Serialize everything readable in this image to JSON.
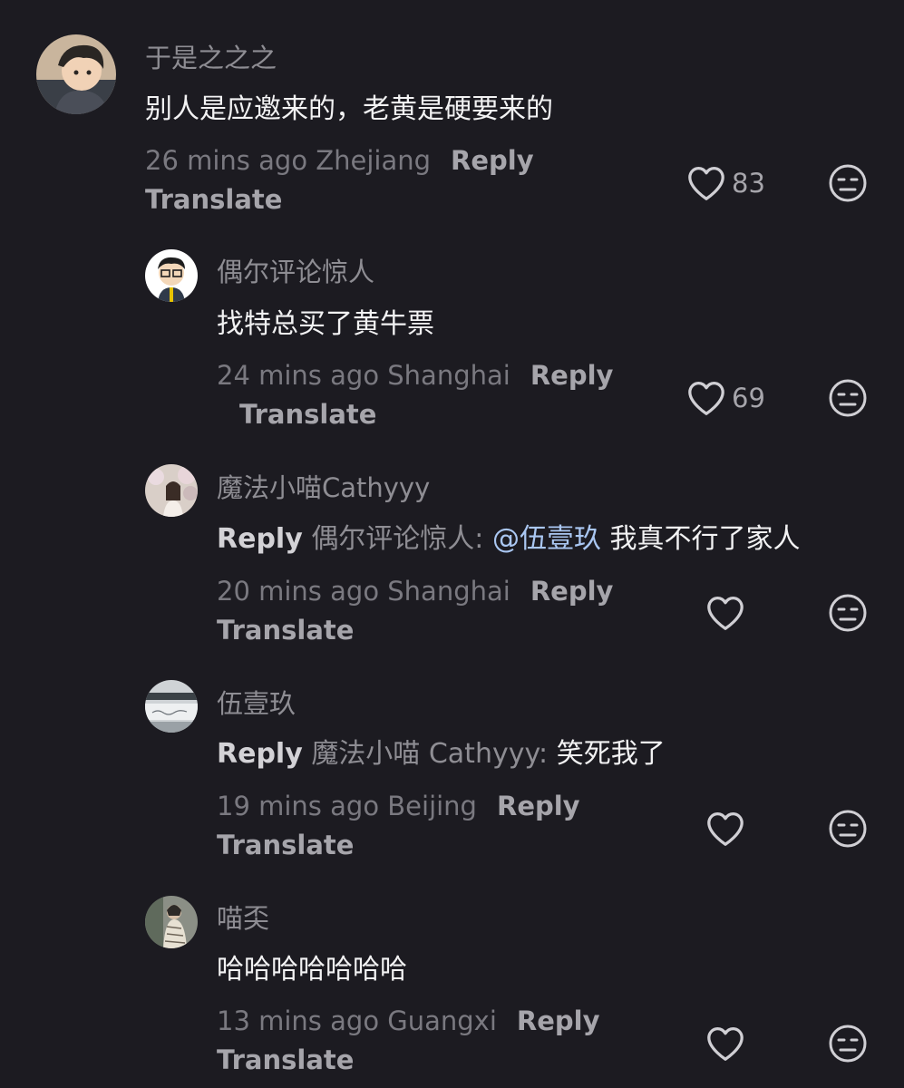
{
  "comments": [
    {
      "username": "于是之之之",
      "text": "别人是应邀来的，老黄是硬要来的",
      "time_location": "26 mins ago Zhejiang",
      "reply_label": "Reply",
      "translate_label": "Translate",
      "likes": "83"
    },
    {
      "username": "偶尔评论惊人",
      "text": "找特总买了黄牛票",
      "time_location": "24 mins ago Shanghai",
      "reply_label": "Reply",
      "translate_label": "Translate",
      "likes": "69"
    },
    {
      "username": "魔法小喵Cathyyy",
      "reply_prefix": "Reply",
      "reply_target": "偶尔评论惊人:",
      "mention": "@伍壹玖",
      "text": "我真不行了家人",
      "time_location": "20 mins ago Shanghai",
      "reply_label": "Reply",
      "translate_label": "Translate"
    },
    {
      "username": "伍壹玖",
      "reply_prefix": "Reply",
      "reply_target": "魔法小喵 Cathyyy:",
      "text": "笑死我了",
      "time_location": "19 mins ago Beijing",
      "reply_label": "Reply",
      "translate_label": "Translate"
    },
    {
      "username": "喵奀",
      "text": "哈哈哈哈哈哈哈",
      "time_location": "13 mins ago Guangxi",
      "reply_label": "Reply",
      "translate_label": "Translate"
    }
  ],
  "icons": {
    "like": "heart-outline-icon",
    "dislike": "meh-face-icon"
  },
  "colors": {
    "background": "#1c1b21",
    "username": "#8e8d93",
    "text": "#f2f2f3",
    "mention": "#aac7f2",
    "meta": "#7a7980"
  }
}
